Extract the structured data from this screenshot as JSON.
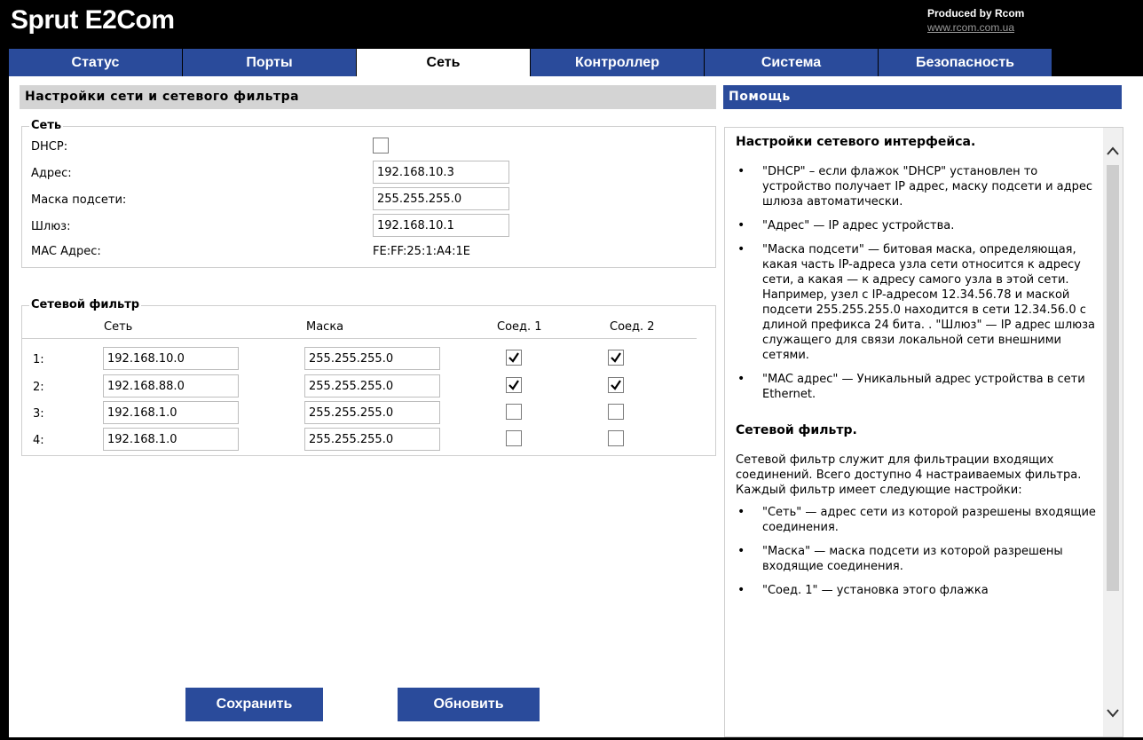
{
  "header": {
    "brand": "Sprut E2Com",
    "produced_by": "Produced by Rcom",
    "site": "www.rcom.com.ua"
  },
  "tabs": [
    {
      "label": "Статус",
      "active": false
    },
    {
      "label": "Порты",
      "active": false
    },
    {
      "label": "Сеть",
      "active": true
    },
    {
      "label": "Контроллер",
      "active": false
    },
    {
      "label": "Система",
      "active": false
    },
    {
      "label": "Безопасность",
      "active": false
    }
  ],
  "main": {
    "title": "Настройки сети и сетевого фильтра",
    "network": {
      "legend": "Сеть",
      "dhcp_label": "DHCP:",
      "dhcp_checked": false,
      "address_label": "Адрес:",
      "address_value": "192.168.10.3",
      "mask_label": "Маска подсети:",
      "mask_value": "255.255.255.0",
      "gateway_label": "Шлюз:",
      "gateway_value": "192.168.10.1",
      "mac_label": "MAC Адрес:",
      "mac_value": "FE:FF:25:1:A4:1E"
    },
    "filter": {
      "legend": "Сетевой фильтр",
      "col_network": "Сеть",
      "col_mask": "Маска",
      "col_conn1": "Соед. 1",
      "col_conn2": "Соед. 2",
      "rows": [
        {
          "index": "1:",
          "network": "192.168.10.0",
          "mask": "255.255.255.0",
          "conn1": true,
          "conn2": true
        },
        {
          "index": "2:",
          "network": "192.168.88.0",
          "mask": "255.255.255.0",
          "conn1": true,
          "conn2": true
        },
        {
          "index": "3:",
          "network": "192.168.1.0",
          "mask": "255.255.255.0",
          "conn1": false,
          "conn2": false
        },
        {
          "index": "4:",
          "network": "192.168.1.0",
          "mask": "255.255.255.0",
          "conn1": false,
          "conn2": false
        }
      ]
    },
    "save_label": "Сохранить",
    "refresh_label": "Обновить"
  },
  "help": {
    "title": "Помощь",
    "heading1": "Настройки сетевого интерфейса.",
    "items1": [
      "\"DHCP\" – если флажок \"DHCP\" установлен то устройство получает IP адрес, маску подсети и адрес шлюза автоматически.",
      "\"Адрес\" — IP адрес устройства.",
      "\"Маска подсети\" — битовая маска, определяющая, какая часть IP-адреса узла сети относится к адресу сети, а какая — к адресу самого узла в этой сети. Например, узел с IP-адресом 12.34.56.78 и маской подсети 255.255.255.0 находится в сети 12.34.56.0 с длиной префикса 24 бита. . \"Шлюз\" — IP адрес шлюза служащего для связи локальной сети внешними сетями.",
      "\"MAC адрес\" — Уникальный адрес устройства в сети Ethernet."
    ],
    "heading2": "Сетевой фильтр.",
    "paragraph2": "Сетевой фильтр служит для фильтрации входящих соединений. Всего доступно 4 настраиваемых фильтра. Каждый фильтр имеет следующие настройки:",
    "items2": [
      "\"Сеть\" — адрес сети из которой разрешены входящие соединения.",
      "\"Маска\" — маска подсети из которой разрешены входящие соединения.",
      "\"Соед. 1\" — установка этого флажка"
    ]
  }
}
